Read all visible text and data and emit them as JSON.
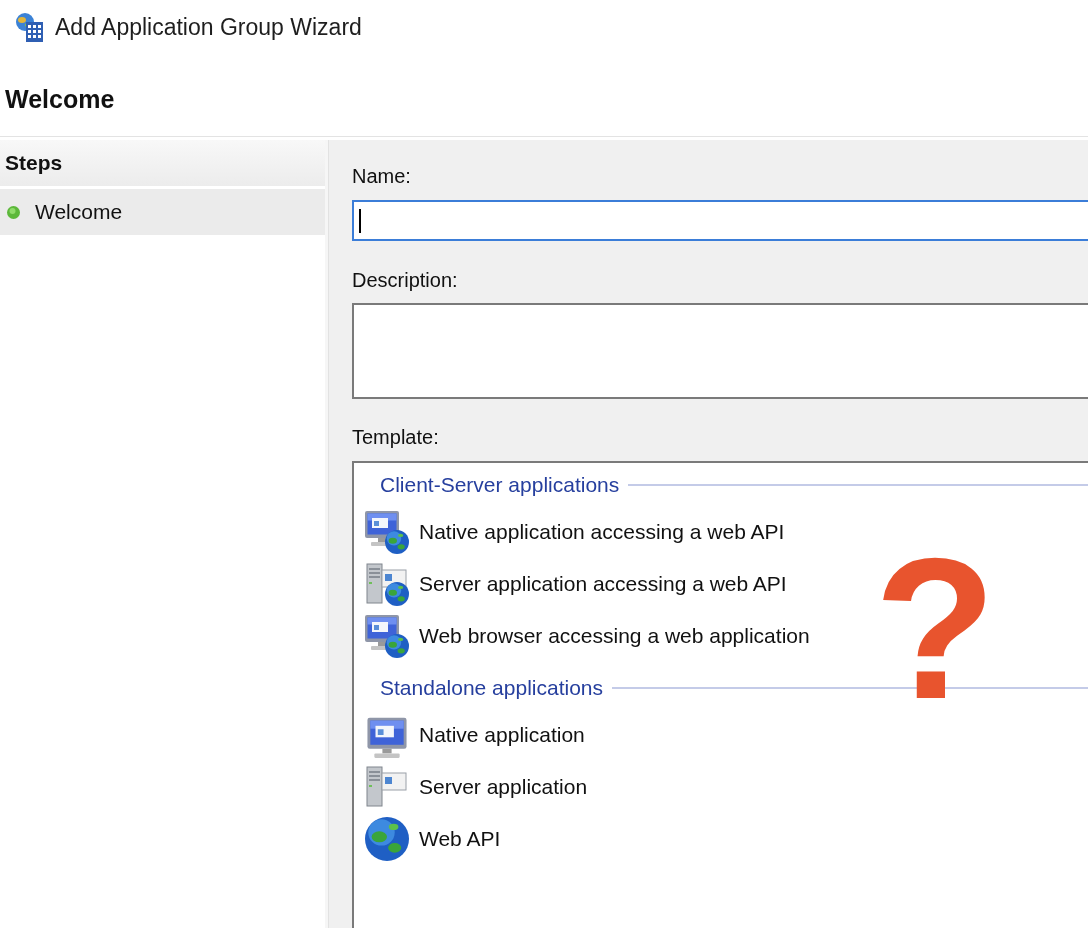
{
  "window": {
    "title": "Add Application Group Wizard"
  },
  "page_heading": "Welcome",
  "steps": {
    "title": "Steps",
    "items": [
      {
        "label": "Welcome",
        "selected": true
      }
    ]
  },
  "form": {
    "name": {
      "label": "Name:",
      "focused": true
    },
    "description": {
      "label": "Description:",
      "focused": false
    },
    "template": {
      "label": "Template:",
      "groups": [
        {
          "title": "Client-Server applications",
          "items": [
            {
              "label": "Native application accessing a web API",
              "kind": "native_api",
              "selected": false
            },
            {
              "label": "Server application accessing a web API",
              "kind": "server_api",
              "selected": false
            },
            {
              "label": "Web browser accessing a web application",
              "kind": "browser_app",
              "selected": false
            }
          ]
        },
        {
          "title": "Standalone applications",
          "items": [
            {
              "label": "Native application",
              "kind": "native",
              "selected": false
            },
            {
              "label": "Server application",
              "kind": "server",
              "selected": false
            },
            {
              "label": "Web API",
              "kind": "web_api",
              "selected": false
            }
          ]
        }
      ]
    }
  },
  "annotation": "?"
}
